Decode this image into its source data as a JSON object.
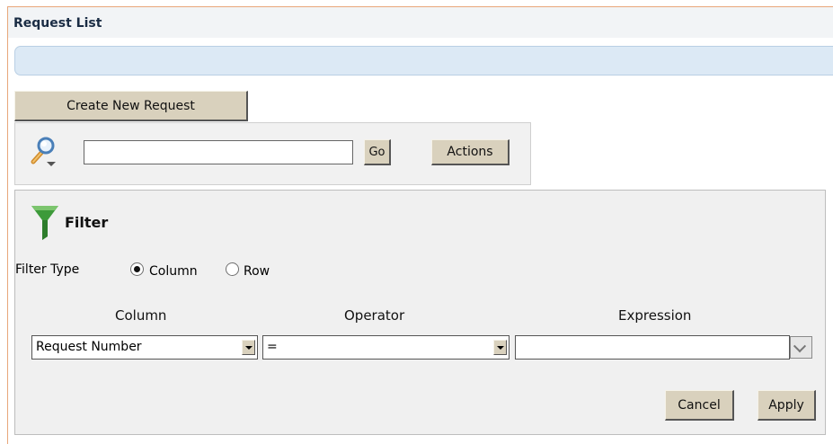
{
  "header": {
    "title": "Request List"
  },
  "toolbar": {
    "create_label": "Create New Request"
  },
  "search": {
    "value": "",
    "go_label": "Go",
    "actions_label": "Actions"
  },
  "filter": {
    "title": "Filter",
    "type_label": "Filter Type",
    "type_options": [
      {
        "label": "Column",
        "selected": true
      },
      {
        "label": "Row",
        "selected": false
      }
    ],
    "headers": {
      "column": "Column",
      "operator": "Operator",
      "expression": "Expression"
    },
    "column_value": "Request Number",
    "operator_value": "=",
    "expression_value": "",
    "cancel_label": "Cancel",
    "apply_label": "Apply"
  },
  "colors": {
    "button_bg": "#d9d1bd",
    "panel_bg": "#f0f0f0",
    "info_band": "#dce9f5",
    "frame_accent": "#e8a77a"
  },
  "icons": {
    "search": "magnifier-dropdown-icon",
    "filter": "funnel-icon"
  }
}
